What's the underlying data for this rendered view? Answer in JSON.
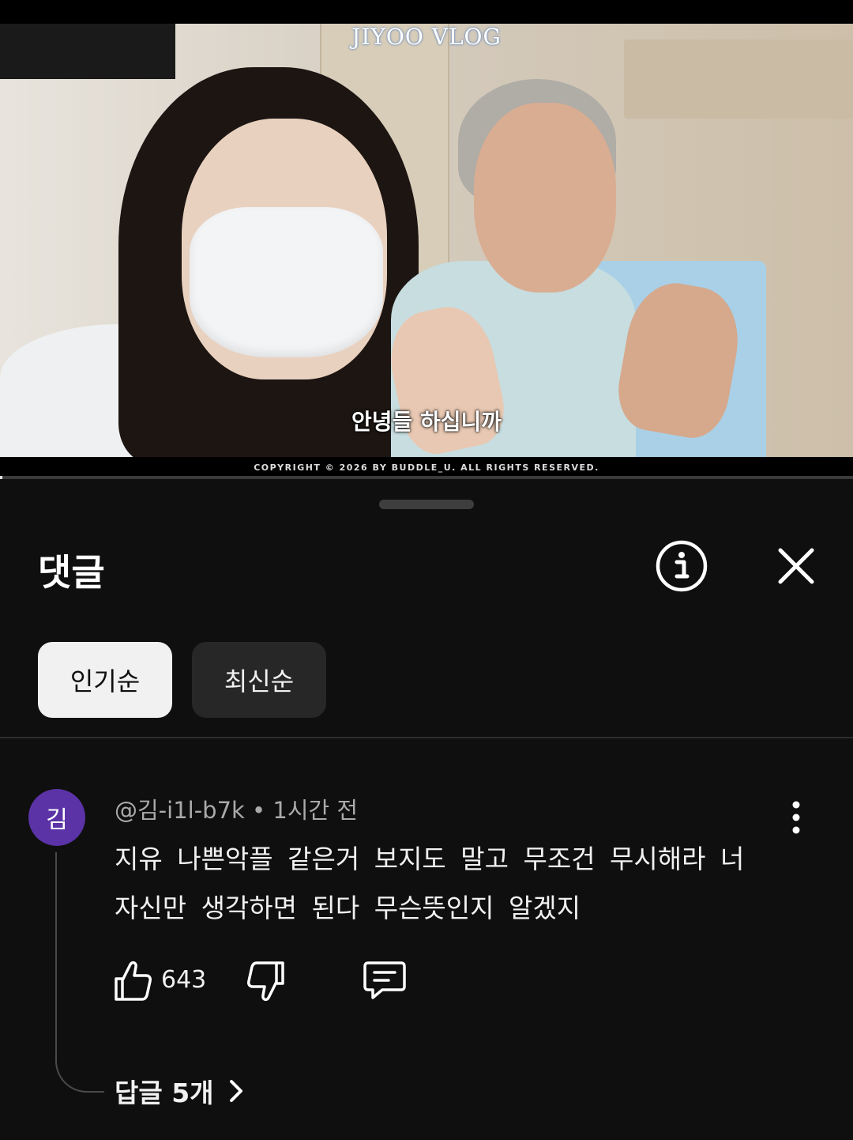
{
  "video": {
    "watermark": "JIYOO VLOG",
    "subtitle": "안녕들 하십니까",
    "copyright": "COPYRIGHT © 2026 BY BUDDLE_U. ALL RIGHTS RESERVED.",
    "progress_fraction": 0.003
  },
  "sheet": {
    "title": "댓글",
    "info_icon": "info-icon",
    "close_icon": "close-icon",
    "sort_chips": [
      {
        "label": "인기순",
        "selected": true
      },
      {
        "label": "최신순",
        "selected": false
      }
    ]
  },
  "comment": {
    "avatar_initial": "김",
    "avatar_color": "#5b33a6",
    "author": "@김-i1l-b7k",
    "separator": "•",
    "time": "1시간 전",
    "text_line1": "지유 나쁜악플 같은거 보지도 말고 무조건 무시해라 너",
    "text_line2": "자신만 생각하면  된다 무슨뜻인지 알겠지",
    "like_count": "643",
    "replies_label": "답글 5개"
  }
}
